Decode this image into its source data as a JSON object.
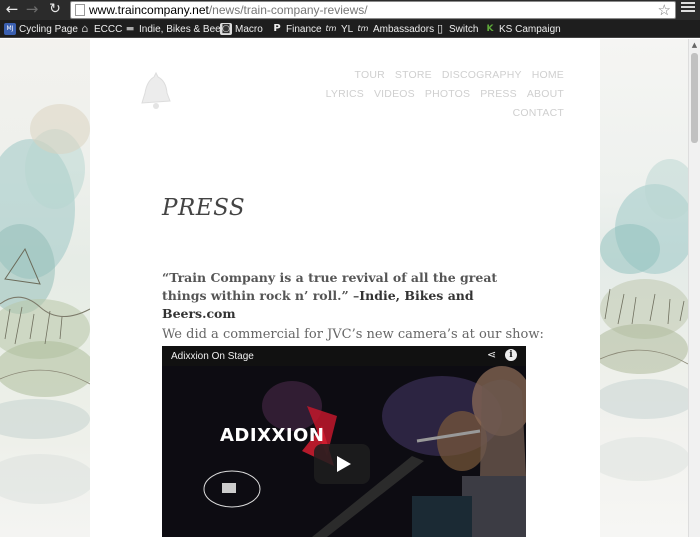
{
  "browser": {
    "url_host": "www.traincompany.net",
    "url_path": "/news/train-company-reviews/",
    "back_label": "←",
    "forward_label": "→",
    "reload_label": "↻",
    "star_label": "☆"
  },
  "bookmarks": [
    {
      "label": "Cycling Page",
      "icon": "blog-icon",
      "glyph": "MJ",
      "color": "#3a5fb0"
    },
    {
      "label": "ECCC",
      "icon": "building-icon",
      "glyph": "⌂",
      "color": "#777777"
    },
    {
      "label": "Indie, Bikes & Beer",
      "icon": "page-icon",
      "glyph": "▬",
      "color": "#888888"
    },
    {
      "label": "Macro",
      "icon": "camera-icon",
      "glyph": "◙",
      "color": "#6a6a6a"
    },
    {
      "label": "Finance",
      "icon": "p-icon",
      "glyph": "P",
      "color": "#2b2b2b"
    },
    {
      "label": "YL",
      "icon": "tm-icon",
      "glyph": "tm",
      "color": "#2b2b2b"
    },
    {
      "label": "Ambassadors",
      "icon": "tm-icon",
      "glyph": "tm",
      "color": "#2b2b2b"
    },
    {
      "label": "Switch",
      "icon": "document-icon",
      "glyph": "▯",
      "color": "#dddddd"
    },
    {
      "label": "KS Campaign",
      "icon": "kickstarter-icon",
      "glyph": "K",
      "color": "#5ea83a"
    }
  ],
  "site_nav": {
    "row1": [
      "TOUR",
      "STORE",
      "DISCOGRAPHY",
      "HOME"
    ],
    "row2": [
      "LYRICS",
      "VIDEOS",
      "PHOTOS",
      "PRESS",
      "ABOUT"
    ],
    "row3": [
      "CONTACT"
    ]
  },
  "page": {
    "title": "PRESS",
    "quote": "“Train Company is a true revival of all the great things within rock n’ roll.” –",
    "quote_source": "Indie, Bikes and Beers.com",
    "commercial_text": "We did a commercial for JVC’s new camera’s at our show:"
  },
  "video": {
    "title": "Adixxion On Stage",
    "brand": "ADIXXION",
    "share_label": "⋖",
    "info_label": "i"
  }
}
